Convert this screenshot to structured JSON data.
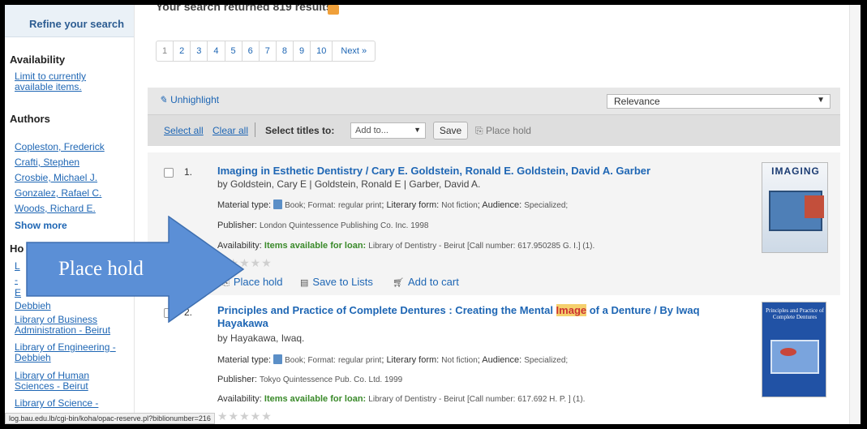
{
  "sidebar": {
    "refine_title": "Refine your search",
    "availability_title": "Availability",
    "availability_link": "Limit to currently available items.",
    "authors_title": "Authors",
    "authors": [
      "Copleston, Frederick",
      "Crafti, Stephen",
      "Crosbie, Michael J.",
      "Gonzalez, Rafael C.",
      "Woods, Richard E."
    ],
    "show_more": "Show more",
    "holding_title_partial": "Ho",
    "holding_partial_1": "L",
    "holding_partial_2": "-",
    "holding_partial_3": "E",
    "libraries": [
      "Debbieh",
      "Library of Business Administration - Beirut",
      "Library of Engineering - Debbieh",
      "Library of Human Sciences - Beirut",
      "Library of Science -"
    ]
  },
  "main": {
    "results_text": "Your search returned 819 results.",
    "pages": [
      "1",
      "2",
      "3",
      "4",
      "5",
      "6",
      "7",
      "8",
      "9",
      "10"
    ],
    "next_label": "Next »",
    "unhighlight": "Unhighlight",
    "sort_value": "Relevance",
    "select_all": "Select all",
    "clear_all": "Clear all",
    "select_titles_to": "Select titles to:",
    "add_to_value": "Add to...",
    "save_label": "Save",
    "place_hold_toolbar": "Place hold"
  },
  "results": [
    {
      "number": "1.",
      "title": "Imaging in Esthetic Dentistry / Cary E. Goldstein, Ronald E. Goldstein, David A. Garber",
      "byline": "by Goldstein, Cary E | Goldstein, Ronald E | Garber, David A.",
      "material_label": "Material type:",
      "material_value": "Book; Format:",
      "format_value": "regular print",
      "literary_label": "; Literary form:",
      "literary_value": "Not fiction",
      "audience_label": "; Audience:",
      "audience_value": "Specialized;",
      "publisher_label": "Publisher:",
      "publisher_value": "London Quintessence Publishing Co. Inc. 1998",
      "availability_label": "Availability:",
      "availability_green": "Items available for loan:",
      "availability_value": "Library of Dentistry - Beirut [Call number: 617.950285 G. I.] (1).",
      "cover_title": "IMAGING",
      "actions": [
        "Place hold",
        "Save to Lists",
        "Add to cart"
      ]
    },
    {
      "number": "2.",
      "title_before": "Principles and Practice of Complete Dentures : Creating the Mental ",
      "title_highlight": "Image",
      "title_after": " of a Denture / By Iwaq Hayakawa",
      "byline": "by Hayakawa, Iwaq.",
      "material_label": "Material type:",
      "material_value": "Book; Format:",
      "format_value": "regular print",
      "literary_label": "; Literary form:",
      "literary_value": "Not fiction",
      "audience_label": "; Audience:",
      "audience_value": "Specialized;",
      "publisher_label": "Publisher:",
      "publisher_value": "Tokyo Quintessence Pub. Co. Ltd. 1999",
      "availability_label": "Availability:",
      "availability_green": "Items available for loan:",
      "availability_value": "Library of Dentistry - Beirut [Call number: 617.692 H. P. ] (1).",
      "cover_title": "Principles and Practice of Complete Dentures"
    }
  ],
  "callout": {
    "text": "Place hold",
    "color": "#5b8fd6"
  },
  "status_url": "log.bau.edu.lb/cgi-bin/koha/opac-reserve.pl?biblionumber=216",
  "colors": {
    "link": "#1e66b4",
    "available": "#3a8a2a",
    "highlight": "#f5d06d"
  }
}
